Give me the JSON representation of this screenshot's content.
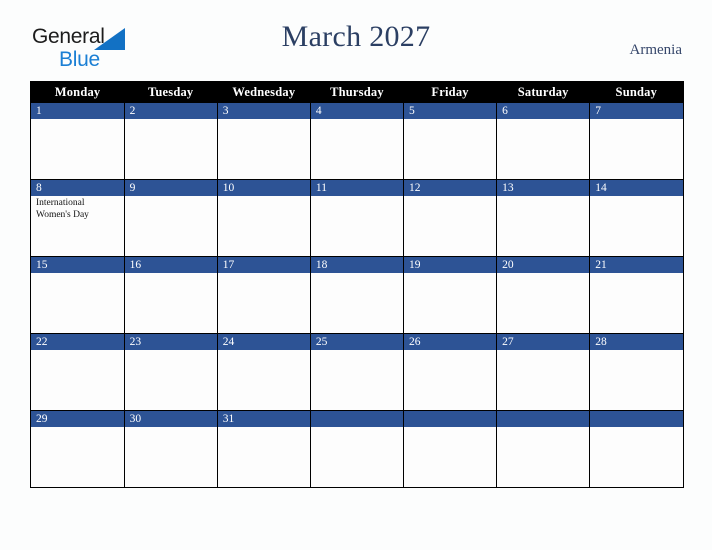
{
  "brand": {
    "name_part1": "General",
    "name_part2": "Blue",
    "triangle_color": "#1271c4",
    "text_color_1": "#1c1c1c",
    "text_color_2": "#1b7fd4"
  },
  "header": {
    "title": "March 2027",
    "country": "Armenia",
    "title_color": "#2b3f63",
    "country_color": "#36476b"
  },
  "theme": {
    "header_row_bg": "#000000",
    "header_row_text": "#ffffff",
    "date_band_bg": "#2d5395",
    "date_band_text": "#ffffff",
    "cell_bg": "#fdfdfd",
    "grid_line": "#000000",
    "page_bg": "#fcfdfd"
  },
  "weekdays": [
    "Monday",
    "Tuesday",
    "Wednesday",
    "Thursday",
    "Friday",
    "Saturday",
    "Sunday"
  ],
  "weeks": [
    [
      {
        "day": "1",
        "events": []
      },
      {
        "day": "2",
        "events": []
      },
      {
        "day": "3",
        "events": []
      },
      {
        "day": "4",
        "events": []
      },
      {
        "day": "5",
        "events": []
      },
      {
        "day": "6",
        "events": []
      },
      {
        "day": "7",
        "events": []
      }
    ],
    [
      {
        "day": "8",
        "events": [
          "International Women's Day"
        ]
      },
      {
        "day": "9",
        "events": []
      },
      {
        "day": "10",
        "events": []
      },
      {
        "day": "11",
        "events": []
      },
      {
        "day": "12",
        "events": []
      },
      {
        "day": "13",
        "events": []
      },
      {
        "day": "14",
        "events": []
      }
    ],
    [
      {
        "day": "15",
        "events": []
      },
      {
        "day": "16",
        "events": []
      },
      {
        "day": "17",
        "events": []
      },
      {
        "day": "18",
        "events": []
      },
      {
        "day": "19",
        "events": []
      },
      {
        "day": "20",
        "events": []
      },
      {
        "day": "21",
        "events": []
      }
    ],
    [
      {
        "day": "22",
        "events": []
      },
      {
        "day": "23",
        "events": []
      },
      {
        "day": "24",
        "events": []
      },
      {
        "day": "25",
        "events": []
      },
      {
        "day": "26",
        "events": []
      },
      {
        "day": "27",
        "events": []
      },
      {
        "day": "28",
        "events": []
      }
    ],
    [
      {
        "day": "29",
        "events": []
      },
      {
        "day": "30",
        "events": []
      },
      {
        "day": "31",
        "events": []
      },
      {
        "day": "",
        "events": []
      },
      {
        "day": "",
        "events": []
      },
      {
        "day": "",
        "events": []
      },
      {
        "day": "",
        "events": []
      }
    ]
  ]
}
